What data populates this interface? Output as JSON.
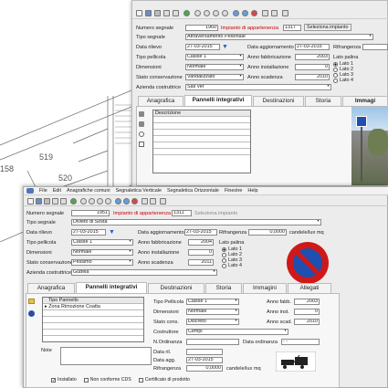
{
  "back": {
    "fields": {
      "numero_segnale": "1960",
      "impianto_link": "Impianto di appartenenza",
      "impianto_num": "1317",
      "seleziona_btn": "Seleziona impianto",
      "tipo_segnale": "Attraversamento Pedonale",
      "data_rilievo": "27-03-2015",
      "data_aggiornamento": "27-03-2015",
      "tipo_pellicola": "Classe 1",
      "anno_fabbricazione": "2003",
      "dimensioni": "Normale",
      "anno_installazione": "0",
      "stato_conservazione": "Vandalizzato",
      "anno_scadenza": "2010",
      "azienda": "Sali Ver"
    },
    "labels": {
      "numero_segnale": "Numero segnale",
      "tipo_segnale": "Tipo segnale",
      "data_rilievo": "Data rilievo",
      "data_aggiornamento": "Data aggiornamento",
      "rifrangenza": "Rifrangenza",
      "tipo_pellicola": "Tipo pellicola",
      "anno_fabbricazione": "Anno fabbricazione",
      "lato_palina": "Lato palina",
      "dimensioni": "Dimensioni",
      "anno_installazione": "Anno installazione",
      "stato_conservazione": "Stato conservazione",
      "anno_scadenza": "Anno scadenza",
      "azienda": "Azienda costruttrice"
    },
    "lato": [
      "Lato 1",
      "Lato 2",
      "Lato 3",
      "Lato 4"
    ],
    "tabs": [
      "Anagrafica",
      "Pannelli integrativi",
      "Destinazioni",
      "Storia",
      "Immagi"
    ],
    "grid_header": "Descrizione"
  },
  "map": {
    "labels": [
      "519",
      "520",
      "158"
    ]
  },
  "front": {
    "menu": [
      "File",
      "Edit",
      "Anagrafiche comuni",
      "Segnaletica Verticale",
      "Segnaletica Orizzontale",
      "Finestre",
      "Help"
    ],
    "fields": {
      "numero_segnale": "1951",
      "impianto_link": "Impianto di appartenenza",
      "impianto_num": "1311",
      "seleziona_btn": "Seleziona impianto",
      "tipo_segnale": "Divieto di Sosta",
      "data_rilievo": "27-03-2015",
      "data_aggiornamento": "27-03-2015",
      "rifrangenza": "0,0000",
      "rifrangenza_unit": "candele/lux mq",
      "tipo_pellicola": "Classe 1",
      "anno_fabbricazione": "2004",
      "dimensioni": "Normale",
      "anno_installazione": "0",
      "stato_conservazione": "Pessimo",
      "anno_scadenza": "2011",
      "azienda": "Gubela"
    },
    "labels": {
      "numero_segnale": "Numero segnale",
      "tipo_segnale": "Tipo segnale",
      "data_rilievo": "Data rilievo",
      "data_aggiornamento": "Data aggiornamento",
      "rifrangenza": "Rifrangenza",
      "tipo_pellicola": "Tipo pellicola",
      "anno_fabbricazione": "Anno fabbricazione",
      "lato_palina": "Lato palina",
      "dimensioni": "Dimensioni",
      "anno_installazione": "Anno installazione",
      "stato_conservazione": "Stato conservazione",
      "anno_scadenza": "Anno scadenza",
      "azienda": "Azienda costruttrice"
    },
    "lato": [
      "Lato 1",
      "Lato 2",
      "Lato 3",
      "Lato 4"
    ],
    "tabs": [
      "Anagrafica",
      "Pannelli integrativi",
      "Destinazioni",
      "Storia",
      "Immagini",
      "Allegati"
    ],
    "grid_header": "Tipo Pannello",
    "grid_rows": [
      "Zona Rimozione Coatta"
    ],
    "note_label": "Note",
    "panel": {
      "tipo_pellicola_lbl": "Tipo Pellicola",
      "tipo_pellicola": "Classe 1",
      "anno_fabb_lbl": "Anno fabb.",
      "anno_fabb": "2003",
      "dimensioni_lbl": "Dimensioni",
      "dimensioni": "Normale",
      "anno_inst_lbl": "Anno inst.",
      "anno_inst": "0",
      "stato_lbl": "Stato cons.",
      "stato": "Discreto",
      "anno_scad_lbl": "Anno scad.",
      "anno_scad": "2010",
      "costruttore_lbl": "Costruttore",
      "costruttore": "Cempi",
      "n_ordinanza_lbl": "N.Ordinanza",
      "data_ordinanza_lbl": "Data ordinanza",
      "data_ordinanza": "- -",
      "data_ril_lbl": "Data ril.",
      "data_agg_lbl": "Data agg.",
      "data_agg": "27-03-2015",
      "rifrangenza_lbl": "Rifrangenza",
      "rifrangenza": "0,0000",
      "rifrangenza_unit": "candele/lux mq"
    },
    "checkboxes": [
      {
        "label": "Installato",
        "checked": true
      },
      {
        "label": "Non conforme CDS",
        "checked": false
      },
      {
        "label": "Certificato di prodotto",
        "checked": false
      }
    ]
  },
  "colors": {
    "link_red": "#c00000",
    "sign_red": "#d01818",
    "sign_blue": "#1f4fb0",
    "window_bg": "#ececec"
  }
}
